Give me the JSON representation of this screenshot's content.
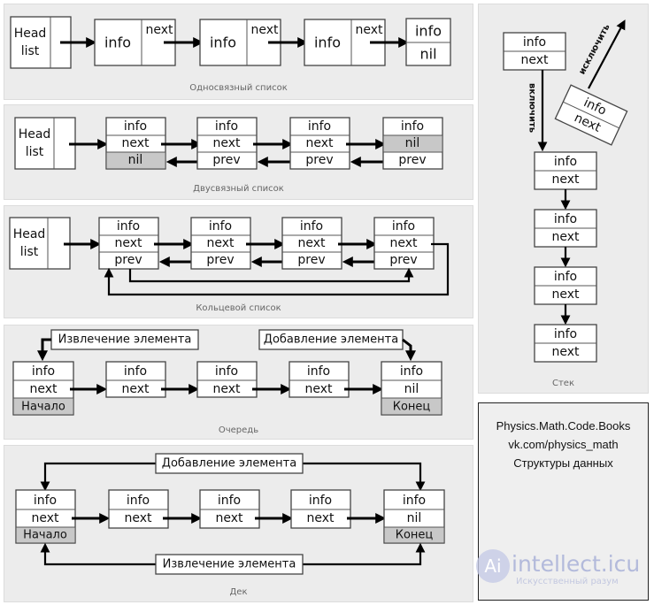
{
  "panels": {
    "singly": {
      "caption": "Односвязный список"
    },
    "doubly": {
      "caption": "Двусвязный список"
    },
    "circular": {
      "caption": "Кольцевой список"
    },
    "queue": {
      "caption": "Очередь"
    },
    "deque": {
      "caption": "Дек"
    },
    "stack": {
      "caption": "Стек"
    }
  },
  "labels": {
    "head": "Head",
    "list": "list",
    "info": "info",
    "next": "next",
    "prev": "prev",
    "nil": "nil",
    "start": "Начало",
    "end": "Конец",
    "extract": "Извлечение элемента",
    "add": "Добавление элемента",
    "push": "включить",
    "pop": "исключить"
  },
  "credit": {
    "line1": "Physics.Math.Code.Books",
    "line2": "vk.com/physics_math",
    "line3": "Структуры данных"
  },
  "watermark": {
    "brand": "intellect.icu",
    "tagline": "Искусственный разум"
  },
  "colors": {
    "panel_bg": "#ececec",
    "nil_cell": "#c8c8c8",
    "watermark": "#b9c0dc"
  }
}
